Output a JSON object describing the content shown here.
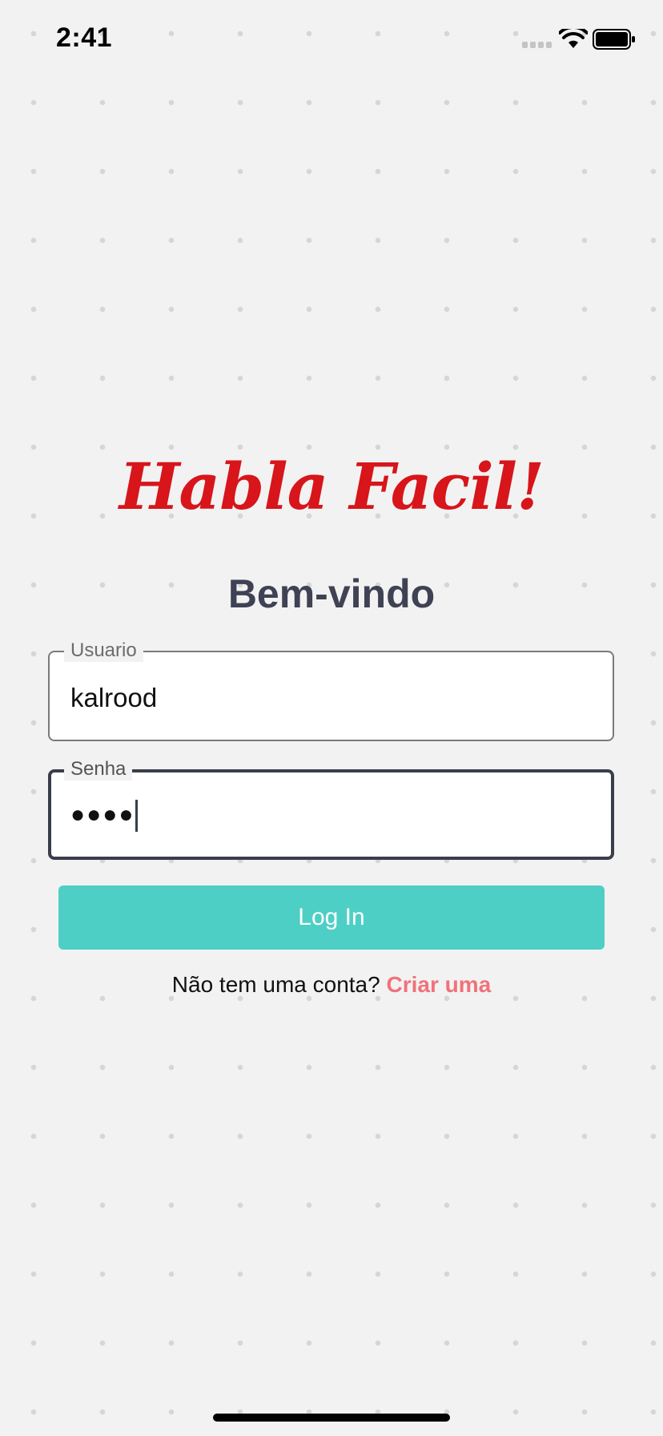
{
  "status_bar": {
    "time": "2:41",
    "icons": [
      "signal-icon",
      "wifi-icon",
      "battery-icon"
    ]
  },
  "app": {
    "logo_text": "Habla Facil!",
    "logo_color": "#d7151a"
  },
  "welcome": {
    "title": "Bem-vindo"
  },
  "form": {
    "username": {
      "label": "Usuario",
      "value": "kalrood"
    },
    "password": {
      "label": "Senha",
      "masked_value": "●●●●"
    },
    "login_button": {
      "label": "Log In",
      "color": "#4ecfc5"
    },
    "signup": {
      "prompt": "Não tem uma conta?",
      "link": "Criar uma",
      "link_color": "#f0727a"
    }
  }
}
